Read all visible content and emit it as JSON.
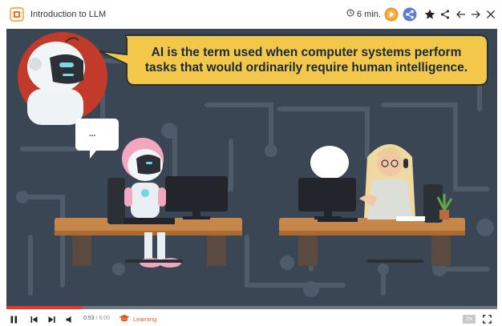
{
  "header": {
    "title": "Introduction to LLM",
    "duration": "6 min.",
    "accent_color": "#f39a1e",
    "share_color": "#5b7fd8"
  },
  "video": {
    "speech_text": "AI is the term used when computer systems perform tasks that would ordinarily require human intelligence.",
    "bubble_dots": "...",
    "progress": 0.155
  },
  "controls": {
    "current_time": "0:53",
    "total_time": "6:00",
    "separator": " / ",
    "learning_label": "Learning",
    "speed_label": "2x"
  },
  "icons": {
    "app": "lesson-icon",
    "clock": "clock-icon",
    "play_badge": "play-badge-icon",
    "share_badge": "share-badge-icon",
    "star": "star-icon",
    "share": "share-icon",
    "back": "arrow-left-icon",
    "forward": "arrow-right-icon",
    "close": "close-icon",
    "pause": "pause-icon",
    "prev": "skip-previous-icon",
    "next": "skip-next-icon",
    "volume": "volume-icon",
    "graduation": "graduation-cap-icon",
    "fullscreen": "fullscreen-icon"
  }
}
